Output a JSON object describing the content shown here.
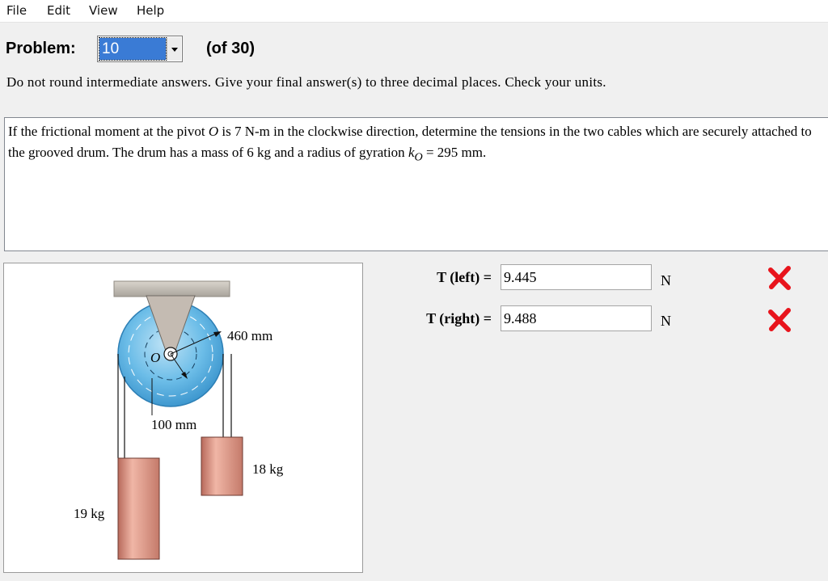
{
  "menu": {
    "file": "File",
    "edit": "Edit",
    "view": "View",
    "help": "Help"
  },
  "problem": {
    "label": "Problem:",
    "selected": "10",
    "of_total": "(of 30)"
  },
  "instructions": "Do not round intermediate answers.  Give your final answer(s) to three decimal places.  Check your units.",
  "question": {
    "part1": "If the frictional moment at the pivot ",
    "pivot": "O",
    "part2": " is 7 N-m in the clockwise direction, determine the tensions in the two cables which are securely attached to the grooved drum.  The drum has a mass of 6 kg and a radius of gyration ",
    "k": "k",
    "k_sub": "O",
    "part3": " = 295 mm."
  },
  "figure": {
    "outer_radius": "460 mm",
    "inner_radius": "100 mm",
    "pivot": "O",
    "right_mass": "18 kg",
    "left_mass": "19 kg"
  },
  "answers": [
    {
      "label": "T (left) =",
      "value": "9.445",
      "unit": "N",
      "status": "incorrect"
    },
    {
      "label": "T (right) =",
      "value": "9.488",
      "unit": "N",
      "status": "incorrect"
    }
  ],
  "colors": {
    "drum": "#5ab0e0",
    "incorrect": "#e8141c",
    "mass": "#d98878",
    "selection": "#3a7bd5"
  }
}
